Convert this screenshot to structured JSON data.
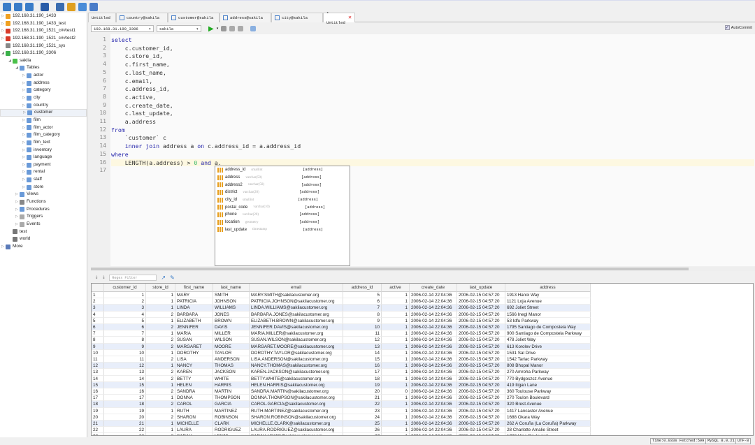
{
  "toolbar": {
    "icons": [
      "connect-icon",
      "new-query-icon",
      "open-folder-icon",
      "save-icon",
      "find-icon",
      "user-icon",
      "wand-icon",
      "clipboard-icon"
    ]
  },
  "tree": {
    "nodes": [
      {
        "label": "192.168.31.190_1433",
        "type": "mssql",
        "level": 0,
        "arrow": "▷"
      },
      {
        "label": "192.168.31.190_1433_test",
        "type": "mssql",
        "level": 0,
        "arrow": "▷"
      },
      {
        "label": "192.168.31.190_1521_c##test1",
        "type": "oracle",
        "level": 0,
        "arrow": "▷"
      },
      {
        "label": "192.168.31.190_1521_c##test2",
        "type": "oracle",
        "level": 0,
        "arrow": "▷"
      },
      {
        "label": "192.168.31.190_1521_sys",
        "type": "oracle-off",
        "level": 0,
        "arrow": ""
      },
      {
        "label": "192.168.31.190_3306",
        "type": "mysql",
        "level": 0,
        "arrow": "◢"
      },
      {
        "label": "sakila",
        "type": "db",
        "level": 1,
        "arrow": "◢"
      },
      {
        "label": "Tables",
        "type": "folder",
        "level": 2,
        "arrow": "◢"
      },
      {
        "label": "actor",
        "type": "table",
        "level": 3,
        "arrow": "▷"
      },
      {
        "label": "address",
        "type": "table",
        "level": 3,
        "arrow": "▷"
      },
      {
        "label": "category",
        "type": "table",
        "level": 3,
        "arrow": "▷"
      },
      {
        "label": "city",
        "type": "table",
        "level": 3,
        "arrow": "▷"
      },
      {
        "label": "country",
        "type": "table",
        "level": 3,
        "arrow": "▷"
      },
      {
        "label": "customer",
        "type": "table",
        "level": 3,
        "arrow": "▷",
        "selected": true
      },
      {
        "label": "film",
        "type": "table",
        "level": 3,
        "arrow": "▷"
      },
      {
        "label": "film_actor",
        "type": "table",
        "level": 3,
        "arrow": "▷"
      },
      {
        "label": "film_category",
        "type": "table",
        "level": 3,
        "arrow": "▷"
      },
      {
        "label": "film_text",
        "type": "table",
        "level": 3,
        "arrow": "▷"
      },
      {
        "label": "inventory",
        "type": "table",
        "level": 3,
        "arrow": "▷"
      },
      {
        "label": "language",
        "type": "table",
        "level": 3,
        "arrow": "▷"
      },
      {
        "label": "payment",
        "type": "table",
        "level": 3,
        "arrow": "▷"
      },
      {
        "label": "rental",
        "type": "table",
        "level": 3,
        "arrow": "▷"
      },
      {
        "label": "staff",
        "type": "table",
        "level": 3,
        "arrow": "▷"
      },
      {
        "label": "store",
        "type": "table",
        "level": 3,
        "arrow": "▷"
      },
      {
        "label": "Views",
        "type": "views",
        "level": 2,
        "arrow": "▷"
      },
      {
        "label": "Functions",
        "type": "functions",
        "level": 2,
        "arrow": "▷"
      },
      {
        "label": "Procedures",
        "type": "procedures",
        "level": 2,
        "arrow": "▷"
      },
      {
        "label": "Triggers",
        "type": "triggers",
        "level": 2,
        "arrow": "▷"
      },
      {
        "label": "Events",
        "type": "events",
        "level": 2,
        "arrow": "▷"
      },
      {
        "label": "test",
        "type": "db-off",
        "level": 1,
        "arrow": ""
      },
      {
        "label": "world",
        "type": "db-off",
        "level": 1,
        "arrow": ""
      },
      {
        "label": "More",
        "type": "more",
        "level": 0,
        "arrow": "▷"
      }
    ]
  },
  "tabs": [
    {
      "label": "Untitled",
      "icon": false
    },
    {
      "label": "country@sakila",
      "icon": true
    },
    {
      "label": "customer@sakila",
      "icon": true
    },
    {
      "label": "address@sakila",
      "icon": true
    },
    {
      "label": "city@sakila",
      "icon": true
    },
    {
      "label": "* Untitled",
      "icon": false,
      "active": true
    }
  ],
  "editor_bar": {
    "connection": "192.168.31.190_3306",
    "database": "sakila",
    "autocommit_label": "AutoCommit",
    "autocommit": true
  },
  "editor": {
    "lines": [
      [
        [
          "kw",
          "select"
        ]
      ],
      [
        [
          "",
          "    c.customer_id,"
        ]
      ],
      [
        [
          "",
          "    c.store_id,"
        ]
      ],
      [
        [
          "",
          "    c.first_name,"
        ]
      ],
      [
        [
          "",
          "    c.last_name,"
        ]
      ],
      [
        [
          "",
          "    c.email,"
        ]
      ],
      [
        [
          "",
          "    c.address_id,"
        ]
      ],
      [
        [
          "",
          "    c.active,"
        ]
      ],
      [
        [
          "",
          "    c.create_date,"
        ]
      ],
      [
        [
          "",
          "    c.last_update,"
        ]
      ],
      [
        [
          "",
          "    a.address"
        ]
      ],
      [
        [
          "kw",
          "from"
        ]
      ],
      [
        [
          "",
          "    `customer` c"
        ]
      ],
      [
        [
          "",
          "    "
        ],
        [
          "kw",
          "inner join"
        ],
        [
          "",
          " address a "
        ],
        [
          "kw",
          "on"
        ],
        [
          "",
          " c.address_id = a.address_id"
        ]
      ],
      [
        [
          "kw",
          "where"
        ]
      ],
      [
        [
          "",
          "    LENGTH(a.address) > "
        ],
        [
          "num",
          "0"
        ],
        [
          "",
          " "
        ],
        [
          "kw",
          "and"
        ],
        [
          "",
          " a."
        ]
      ],
      [
        [
          "",
          ""
        ]
      ]
    ]
  },
  "autocomplete": [
    {
      "name": "address_id",
      "type": "smallint",
      "table": "[address]"
    },
    {
      "name": "address",
      "type": "varchar(50)",
      "table": "[address]"
    },
    {
      "name": "address2",
      "type": "varchar(50)",
      "table": "[address]"
    },
    {
      "name": "district",
      "type": "varchar(20)",
      "table": "[address]"
    },
    {
      "name": "city_id",
      "type": "smallint",
      "table": "[address]"
    },
    {
      "name": "postal_code",
      "type": "varchar(10)",
      "table": "[address]"
    },
    {
      "name": "phone",
      "type": "varchar(20)",
      "table": "[address]"
    },
    {
      "name": "location",
      "type": "geometry",
      "table": "[address]"
    },
    {
      "name": "last_update",
      "type": "timestamp",
      "table": "[address]"
    }
  ],
  "results": {
    "filter_placeholder": "Regex Filter",
    "columns": [
      "customer_id",
      "store_id",
      "first_name",
      "last_name",
      "email",
      "address_id",
      "active",
      "create_date",
      "last_update",
      "address"
    ],
    "rows": [
      [
        1,
        1,
        "MARY",
        "SMITH",
        "MARY.SMITH@sakilacustomer.org",
        5,
        1,
        "1913 Hanoi Way"
      ],
      [
        2,
        1,
        "PATRICIA",
        "JOHNSON",
        "PATRICIA.JOHNSON@sakilacustomer.org",
        6,
        1,
        "1121 Loja Avenue"
      ],
      [
        3,
        1,
        "LINDA",
        "WILLIAMS",
        "LINDA.WILLIAMS@sakilacustomer.org",
        7,
        1,
        "692 Joliet Street"
      ],
      [
        4,
        2,
        "BARBARA",
        "JONES",
        "BARBARA.JONES@sakilacustomer.org",
        8,
        1,
        "1566 Inegl Manor"
      ],
      [
        5,
        1,
        "ELIZABETH",
        "BROWN",
        "ELIZABETH.BROWN@sakilacustomer.org",
        9,
        1,
        "53 Idfu Parkway"
      ],
      [
        6,
        2,
        "JENNIFER",
        "DAVIS",
        "JENNIFER.DAVIS@sakilacustomer.org",
        10,
        1,
        "1795 Santiago de Compostela Way"
      ],
      [
        7,
        1,
        "MARIA",
        "MILLER",
        "MARIA.MILLER@sakilacustomer.org",
        11,
        1,
        "900 Santiago de Compostela Parkway"
      ],
      [
        8,
        2,
        "SUSAN",
        "WILSON",
        "SUSAN.WILSON@sakilacustomer.org",
        12,
        1,
        "478 Joliet Way"
      ],
      [
        9,
        2,
        "MARGARET",
        "MOORE",
        "MARGARET.MOORE@sakilacustomer.org",
        13,
        1,
        "613 Korolev Drive"
      ],
      [
        10,
        1,
        "DOROTHY",
        "TAYLOR",
        "DOROTHY.TAYLOR@sakilacustomer.org",
        14,
        1,
        "1531 Sal Drive"
      ],
      [
        11,
        2,
        "LISA",
        "ANDERSON",
        "LISA.ANDERSON@sakilacustomer.org",
        15,
        1,
        "1542 Tarlac Parkway"
      ],
      [
        12,
        1,
        "NANCY",
        "THOMAS",
        "NANCY.THOMAS@sakilacustomer.org",
        16,
        1,
        "808 Bhopal Manor"
      ],
      [
        13,
        2,
        "KAREN",
        "JACKSON",
        "KAREN.JACKSON@sakilacustomer.org",
        17,
        1,
        "270 Amroha Parkway"
      ],
      [
        14,
        2,
        "BETTY",
        "WHITE",
        "BETTY.WHITE@sakilacustomer.org",
        18,
        1,
        "770 Bydgoszcz Avenue"
      ],
      [
        15,
        1,
        "HELEN",
        "HARRIS",
        "HELEN.HARRIS@sakilacustomer.org",
        19,
        1,
        "419 Iligan Lane"
      ],
      [
        16,
        2,
        "SANDRA",
        "MARTIN",
        "SANDRA.MARTIN@sakilacustomer.org",
        20,
        0,
        "360 Toulouse Parkway"
      ],
      [
        17,
        1,
        "DONNA",
        "THOMPSON",
        "DONNA.THOMPSON@sakilacustomer.org",
        21,
        1,
        "270 Toulon Boulevard"
      ],
      [
        18,
        2,
        "CAROL",
        "GARCIA",
        "CAROL.GARCIA@sakilacustomer.org",
        22,
        1,
        "320 Brest Avenue"
      ],
      [
        19,
        1,
        "RUTH",
        "MARTINEZ",
        "RUTH.MARTINEZ@sakilacustomer.org",
        23,
        1,
        "1417 Lancaster Avenue"
      ],
      [
        20,
        2,
        "SHARON",
        "ROBINSON",
        "SHARON.ROBINSON@sakilacustomer.org",
        24,
        1,
        "1688 Okara Way"
      ],
      [
        21,
        1,
        "MICHELLE",
        "CLARK",
        "MICHELLE.CLARK@sakilacustomer.org",
        25,
        1,
        "262 A Coruña (La Coruña) Parkway"
      ],
      [
        22,
        1,
        "LAURA",
        "RODRIGUEZ",
        "LAURA.RODRIGUEZ@sakilacustomer.org",
        26,
        1,
        "28 Charlotte Amalie Street"
      ],
      [
        23,
        2,
        "SARAH",
        "LEWIS",
        "SARAH.LEWIS@sakilacustomer.org",
        27,
        1,
        "1780 Hino Boulevard"
      ]
    ],
    "create_date": "2006-02-14 22:04:36",
    "last_update": "2006-02-15 04:57:20"
  },
  "status": {
    "time": "Time:0.033s Fetched:599",
    "server": "MySQL 8.0.21",
    "encoding": "UTF-8"
  },
  "colors": {
    "keyword": "#2222aa",
    "number": "#3cba6a",
    "alt_row": "#e8eefa",
    "current_line": "#fdf8e1"
  }
}
